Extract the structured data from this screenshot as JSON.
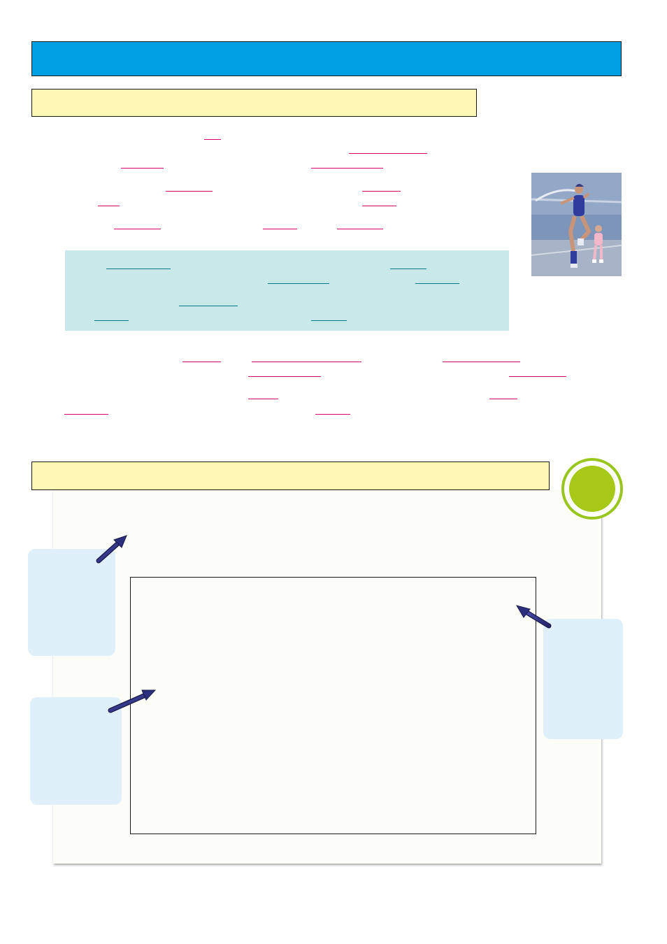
{
  "colors": {
    "title_bar": "#00a0e3",
    "section_bar": "#fff7b4",
    "blank_line": "#d6006e",
    "blank_line_teal": "#007a8a",
    "teal_box": "#c8e8ea",
    "callout": "#dff0fb",
    "badge": "#a6c816",
    "arrow": "#2d2f7e"
  },
  "icons": {
    "badge": "green-circle-badge",
    "arrows": "navy-pointer-arrow",
    "photo": "woman-skipping-rope-with-child-photo"
  }
}
